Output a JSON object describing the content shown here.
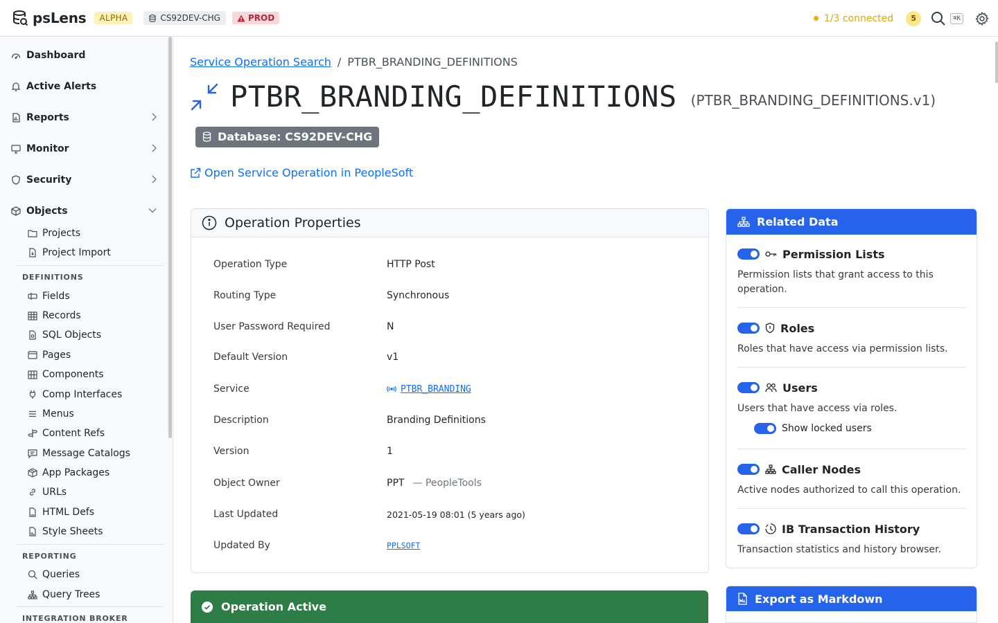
{
  "app": {
    "name": "psLens",
    "alpha_badge": "ALPHA",
    "database_badge": "CS92DEV-CHG",
    "env_badge": "PROD",
    "connection_status": "1/3 connected",
    "notification_count": "5",
    "shortcut_hint": "⌘K"
  },
  "sidebar": {
    "items": [
      {
        "label": "Dashboard",
        "icon": "gauge-icon"
      },
      {
        "label": "Active Alerts",
        "icon": "bell-icon"
      },
      {
        "label": "Reports",
        "icon": "report-icon"
      },
      {
        "label": "Monitor",
        "icon": "monitor-icon"
      },
      {
        "label": "Security",
        "icon": "shield-icon"
      },
      {
        "label": "Objects",
        "icon": "box-icon"
      }
    ],
    "objects_items": [
      {
        "label": "Projects",
        "icon": "folder-icon"
      },
      {
        "label": "Project Import",
        "icon": "file-import-icon"
      }
    ],
    "definitions_heading": "DEFINITIONS",
    "definitions_items": [
      {
        "label": "Fields",
        "icon": "field-icon"
      },
      {
        "label": "Records",
        "icon": "table-icon"
      },
      {
        "label": "SQL Objects",
        "icon": "file-code-icon"
      },
      {
        "label": "Pages",
        "icon": "window-icon"
      },
      {
        "label": "Components",
        "icon": "grid-icon"
      },
      {
        "label": "Comp Interfaces",
        "icon": "plug-icon"
      },
      {
        "label": "Menus",
        "icon": "menu-icon"
      },
      {
        "label": "Content Refs",
        "icon": "signpost-icon"
      },
      {
        "label": "Message Catalogs",
        "icon": "message-icon"
      },
      {
        "label": "App Packages",
        "icon": "package-icon"
      },
      {
        "label": "URLs",
        "icon": "link-icon"
      },
      {
        "label": "HTML Defs",
        "icon": "html-file-icon"
      },
      {
        "label": "Style Sheets",
        "icon": "css-file-icon"
      }
    ],
    "reporting_heading": "REPORTING",
    "reporting_items": [
      {
        "label": "Queries",
        "icon": "search-icon"
      },
      {
        "label": "Query Trees",
        "icon": "tree-icon"
      }
    ],
    "integration_heading": "INTEGRATION BROKER"
  },
  "breadcrumb": {
    "parent": "Service Operation Search",
    "separator": "/",
    "current": "PTBR_BRANDING_DEFINITIONS"
  },
  "header": {
    "title": "PTBR_BRANDING_DEFINITIONS",
    "subtitle": "(PTBR_BRANDING_DEFINITIONS.v1)",
    "database_pill": "Database: CS92DEV-CHG",
    "open_link": "Open Service Operation in PeopleSoft"
  },
  "properties": {
    "heading": "Operation Properties",
    "rows": [
      {
        "label": "Operation Type",
        "value": "HTTP Post"
      },
      {
        "label": "Routing Type",
        "value": "Synchronous"
      },
      {
        "label": "User Password Required",
        "value": "N"
      },
      {
        "label": "Default Version",
        "value": "v1"
      },
      {
        "label": "Service",
        "value": "PTBR_BRANDING"
      },
      {
        "label": "Description",
        "value": "Branding Definitions"
      },
      {
        "label": "Version",
        "value": "1"
      },
      {
        "label": "Object Owner",
        "value": "PPT",
        "extra": "— PeopleTools"
      },
      {
        "label": "Last Updated",
        "value": "2021-05-19 08:01 (5 years ago)"
      },
      {
        "label": "Updated By",
        "value": "PPLSOFT"
      }
    ]
  },
  "related": {
    "heading": "Related Data",
    "items": [
      {
        "title": "Permission Lists",
        "desc": "Permission lists that grant access to this operation.",
        "enabled": true
      },
      {
        "title": "Roles",
        "desc": "Roles that have access via permission lists.",
        "enabled": true
      },
      {
        "title": "Users",
        "desc": "Users that have access via roles.",
        "enabled": true,
        "sub_toggle": "Show locked users"
      },
      {
        "title": "Caller Nodes",
        "desc": "Active nodes authorized to call this operation.",
        "enabled": true
      },
      {
        "title": "IB Transaction History",
        "desc": "Transaction statistics and history browser.",
        "enabled": true
      }
    ]
  },
  "status": {
    "active_label": "Operation Active",
    "color": "#2e7d46"
  },
  "export": {
    "heading": "Export as Markdown"
  },
  "colors": {
    "accent": "#2563eb",
    "link": "#0d6efd",
    "warning": "#e0a800",
    "success": "#2e7d46"
  }
}
